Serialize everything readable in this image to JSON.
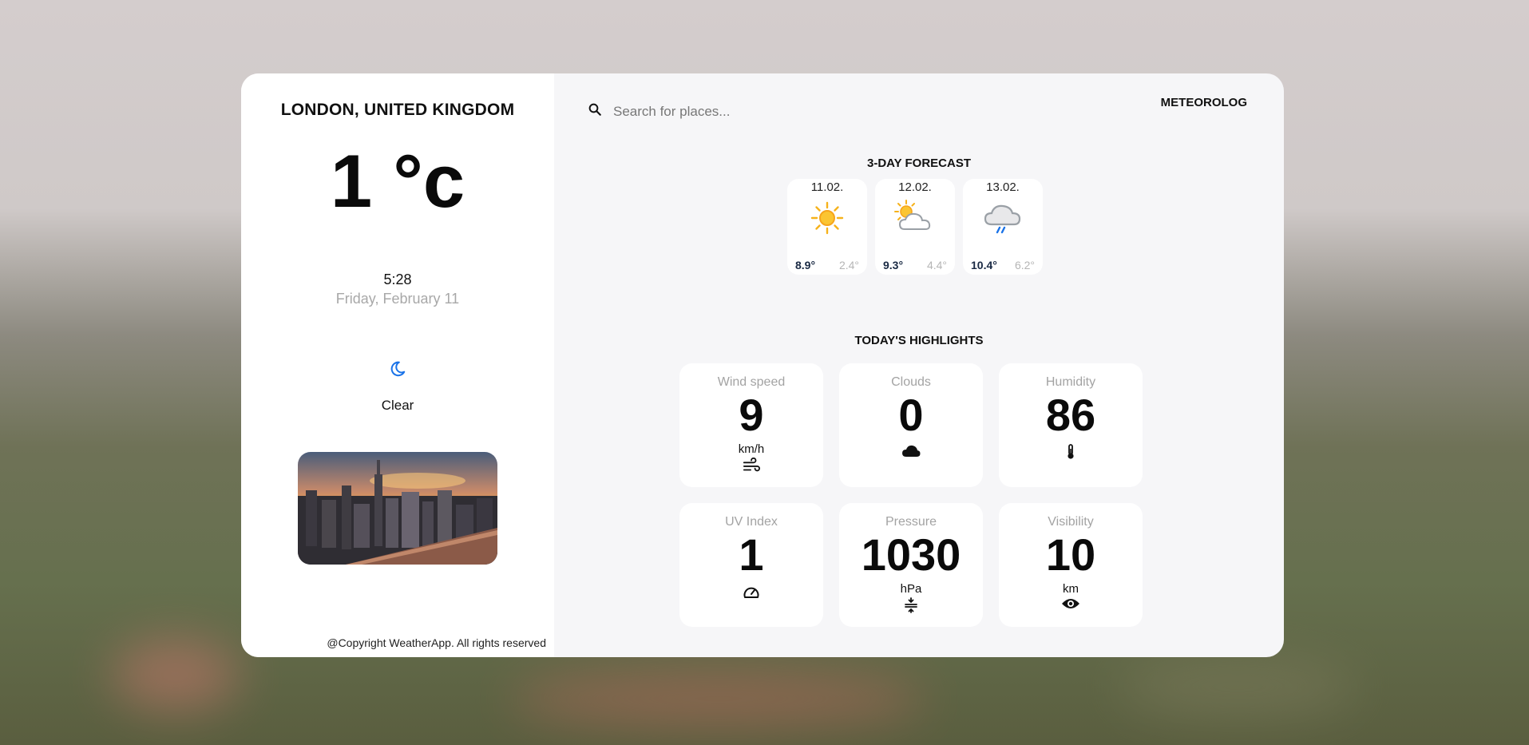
{
  "location": {
    "city": "LONDON, UNITED KINGDOM"
  },
  "current": {
    "temperature": "1 °c",
    "time": "5:28",
    "date": "Friday, February 11",
    "condition_icon": "moon-icon",
    "condition": "Clear"
  },
  "footer": {
    "copyright": "@Copyright WeatherApp. All rights reserved"
  },
  "search": {
    "placeholder": "Search for places..."
  },
  "brand": "METEOROLOG",
  "forecast": {
    "title": "3-DAY FORECAST",
    "days": [
      {
        "date": "11.02.",
        "icon": "sun-icon",
        "max": "8.9°",
        "min": "2.4°"
      },
      {
        "date": "12.02.",
        "icon": "partly-cloudy-icon",
        "max": "9.3°",
        "min": "4.4°"
      },
      {
        "date": "13.02.",
        "icon": "rain-cloud-icon",
        "max": "10.4°",
        "min": "6.2°"
      }
    ]
  },
  "highlights": {
    "title": "TODAY'S HIGHLIGHTS",
    "items": [
      {
        "label": "Wind speed",
        "value": "9",
        "unit": "km/h",
        "icon": "wind-icon"
      },
      {
        "label": "Clouds",
        "value": "0",
        "unit": "",
        "icon": "cloud-icon"
      },
      {
        "label": "Humidity",
        "value": "86",
        "unit": "",
        "icon": "thermometer-icon"
      },
      {
        "label": "UV Index",
        "value": "1",
        "unit": "",
        "icon": "gauge-icon"
      },
      {
        "label": "Pressure",
        "value": "1030",
        "unit": "hPa",
        "icon": "compress-icon"
      },
      {
        "label": "Visibility",
        "value": "10",
        "unit": "km",
        "icon": "eye-icon"
      }
    ]
  },
  "colors": {
    "accent": "#1a73e8",
    "sun": "#f6b21b",
    "panel": "#f6f6f8"
  }
}
